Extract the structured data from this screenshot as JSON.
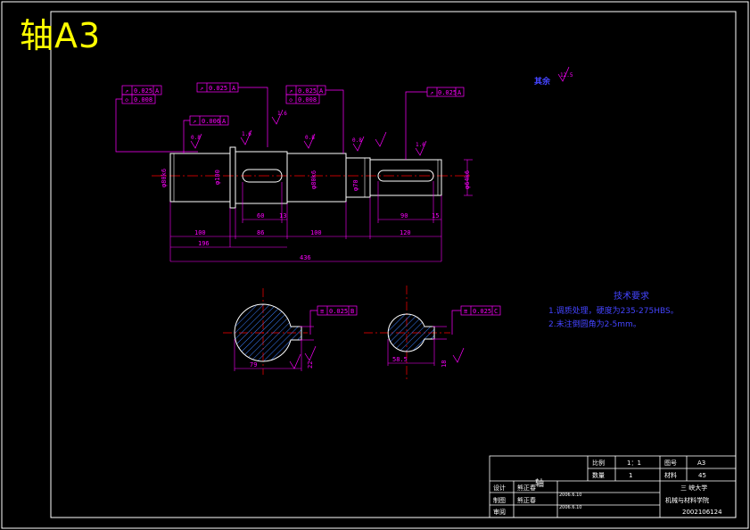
{
  "drawing_title": "轴A3",
  "roughness_other": {
    "label": "其余",
    "value": "12.5"
  },
  "tolerances": {
    "t1_runout": "0.025",
    "t1_datum": "A",
    "t1_cyl": "0.008",
    "t2_runout": "0.025",
    "t2_datum": "A",
    "t3_runout": "0.025",
    "t3_datum": "A",
    "t3_cyl": "0.008",
    "t4_runout": "0.025",
    "t4_datum": "A",
    "t5_runout": "0.006",
    "t5_datum": "A",
    "sec1_sym": "0.025",
    "sec1_datum": "B",
    "sec2_sym": "0.025",
    "sec2_datum": "C"
  },
  "roughness_marks": [
    "0.8",
    "1.6",
    "0.8",
    "0.8",
    "1.6",
    "1.6",
    "3.2",
    "3.2"
  ],
  "diameters": [
    "φ80k6",
    "φ100",
    "φ80k6",
    "φ70",
    "φ64k6"
  ],
  "dimensions": {
    "key1_len": "60",
    "key1_off": "13",
    "key2_len": "90",
    "key2_off": "15",
    "seg_100a": "100",
    "seg_86": "86",
    "seg_100b": "100",
    "seg_120": "120",
    "span_196": "196",
    "total_436": "436",
    "section1_width": "22",
    "section1_depth": "79",
    "section2_width": "18",
    "section2_depth": "58.5"
  },
  "tech_req": {
    "heading": "技术要求",
    "line1": "1.调质处理，硬度为235-275HBS。",
    "line2": "2.未注倒圆角为2-5mm。"
  },
  "title_block": {
    "part_name": "轴",
    "scale_label": "比例",
    "scale_value": "1：1",
    "sheet_label": "图号",
    "sheet_value": "A3",
    "qty_label": "数量",
    "qty_value": "1",
    "material_label": "材料",
    "material_value": "45",
    "design_label": "设计",
    "designer": "熊正春",
    "drawn_label": "制图",
    "drawer": "熊正春",
    "check_label": "审阅",
    "date1": "2006.6.10",
    "date2": "2006.6.10",
    "university": "三 峡大学",
    "college": "机械与材料学院",
    "student_id": "2002106124"
  }
}
